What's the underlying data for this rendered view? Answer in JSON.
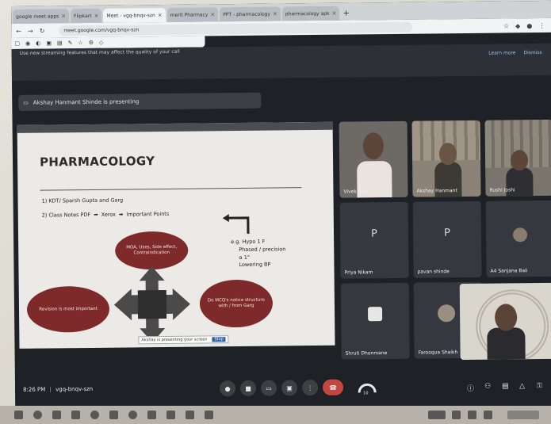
{
  "browser": {
    "tabs": [
      {
        "label": "google meet apps"
      },
      {
        "label": "Flipkart"
      },
      {
        "label": "Meet - vgq-bnqv-szn"
      },
      {
        "label": "merit Pharmacy"
      },
      {
        "label": "PPT - pharmacology"
      },
      {
        "label": "pharmacology apk"
      }
    ],
    "url": "meet.google.com/vgq-bnqv-szn",
    "new_tab": "+"
  },
  "banner": {
    "message": "Use new streaming features that may affect the quality of your call",
    "links": [
      "Learn more",
      "Dismiss"
    ]
  },
  "presenter": {
    "text": "Akshay Hanmant Shinde is presenting"
  },
  "slide": {
    "title": "PHARMACOLOGY",
    "line1": "1) KDT/ Sparsh Gupta and Garg",
    "line2_a": "2) Class Notes PDF",
    "line2_b": "Xerox",
    "line2_c": "Important Points",
    "note": [
      "e.g. Hypo 1 F",
      "Phased / precision",
      "α 1°",
      "Lowering BP"
    ],
    "ellipse_top": "MOA, Uses, Side effect, Contraindication",
    "ellipse_left": "Revision is most important",
    "ellipse_right": "Do MCQ's notice structure with / from Garg",
    "caption": "Akshay is presenting your screen",
    "caption_btn": "Stop"
  },
  "participants": [
    {
      "name": "Vivek Patil"
    },
    {
      "name": "Akshay Hanmant"
    },
    {
      "name": "Rushi Joshi"
    },
    {
      "name": "Priya Nikam",
      "initial": "P"
    },
    {
      "name": "pavan shinde",
      "initial": "P"
    },
    {
      "name": "A4 Sanjana Bali"
    },
    {
      "name": "Shruti Dhonmane"
    },
    {
      "name": "Farooqua Shaikh"
    }
  ],
  "meeting": {
    "time": "8:26 PM",
    "code": "vgq-bnqv-szn",
    "hand_count": "10"
  },
  "colors": {
    "slide_ellipse": "#7e2a2a",
    "end_call": "#c5463e",
    "link": "#9cc1f5"
  }
}
